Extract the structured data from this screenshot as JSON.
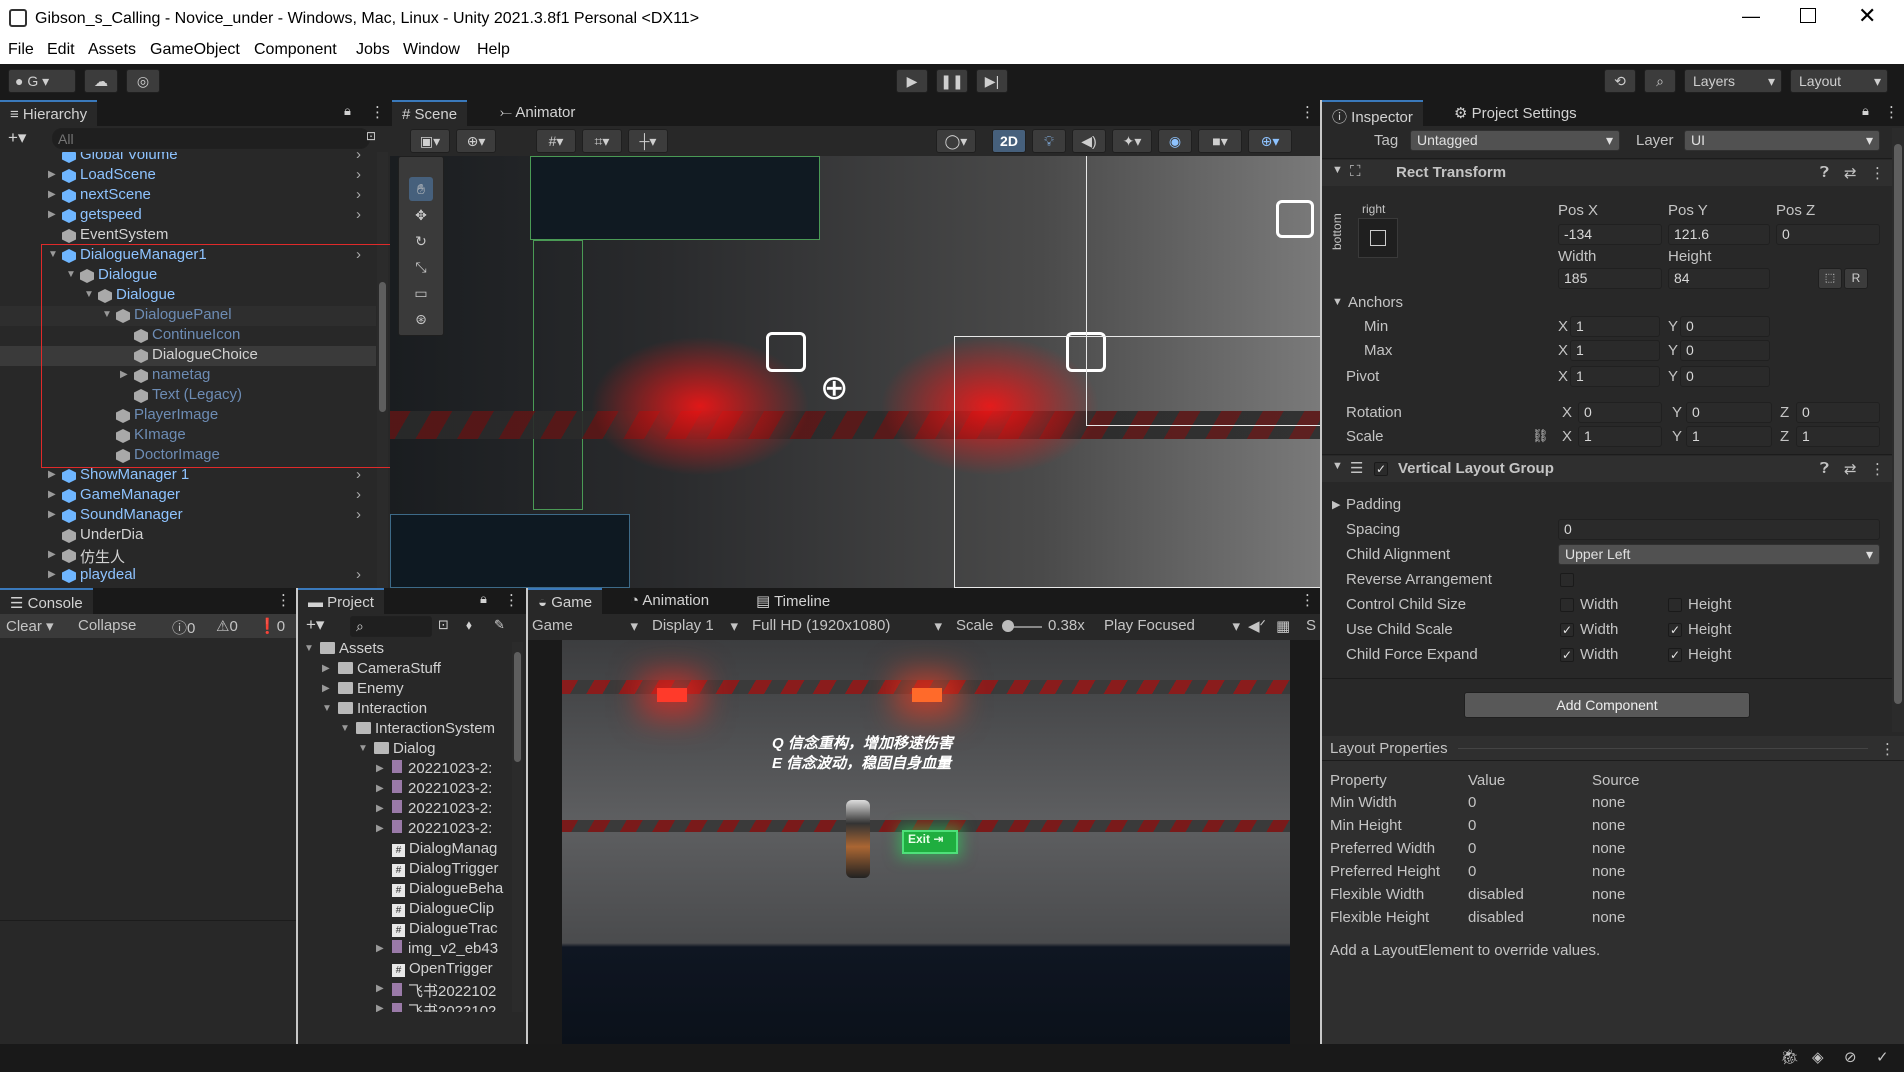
{
  "window": {
    "title": "Gibson_s_Calling - Novice_under - Windows, Mac, Linux - Unity 2021.3.8f1 Personal <DX11>"
  },
  "menu": [
    "File",
    "Edit",
    "Assets",
    "GameObject",
    "Component",
    "Jobs",
    "Window",
    "Help"
  ],
  "toolbar": {
    "account": "G",
    "layers": "Layers",
    "layout": "Layout"
  },
  "hierarchy": {
    "tab": "Hierarchy",
    "search_placeholder": "All",
    "items": [
      {
        "label": "Global Volume",
        "indent": 0,
        "exp": "",
        "icon": "cube",
        "style": "blue",
        "child": true
      },
      {
        "label": "LoadScene",
        "indent": 0,
        "exp": "▶",
        "icon": "cube",
        "style": "blue",
        "child": true
      },
      {
        "label": "nextScene",
        "indent": 0,
        "exp": "▶",
        "icon": "cube",
        "style": "blue",
        "child": true
      },
      {
        "label": "getspeed",
        "indent": 0,
        "exp": "▶",
        "icon": "cube",
        "style": "blue",
        "child": true
      },
      {
        "label": "EventSystem",
        "indent": 0,
        "exp": "",
        "icon": "cubeg",
        "style": "",
        "child": false
      },
      {
        "label": "DialogueManager1",
        "indent": 0,
        "exp": "▼",
        "icon": "cube",
        "style": "blue",
        "child": true
      },
      {
        "label": "Dialogue",
        "indent": 1,
        "exp": "▼",
        "icon": "cubeg",
        "style": "blue",
        "child": false
      },
      {
        "label": "Dialogue",
        "indent": 2,
        "exp": "▼",
        "icon": "cubeg",
        "style": "blue",
        "child": false
      },
      {
        "label": "DialoguePanel",
        "indent": 3,
        "exp": "▼",
        "icon": "cubeg",
        "style": "dim",
        "child": false
      },
      {
        "label": "ContinueIcon",
        "indent": 4,
        "exp": "",
        "icon": "cubeg",
        "style": "dim",
        "child": false
      },
      {
        "label": "DialogueChoice",
        "indent": 4,
        "exp": "",
        "icon": "cubeg",
        "style": "",
        "child": false
      },
      {
        "label": "nametag",
        "indent": 4,
        "exp": "▶",
        "icon": "cubeg",
        "style": "dim",
        "child": false
      },
      {
        "label": "Text (Legacy)",
        "indent": 4,
        "exp": "",
        "icon": "cubeg",
        "style": "dim",
        "child": false
      },
      {
        "label": "PlayerImage",
        "indent": 3,
        "exp": "",
        "icon": "cubeg",
        "style": "dim",
        "child": false
      },
      {
        "label": "KImage",
        "indent": 3,
        "exp": "",
        "icon": "cubeg",
        "style": "dim",
        "child": false
      },
      {
        "label": "DoctorImage",
        "indent": 3,
        "exp": "",
        "icon": "cubeg",
        "style": "dim",
        "child": false
      },
      {
        "label": "ShowManager 1",
        "indent": 0,
        "exp": "▶",
        "icon": "cube",
        "style": "blue",
        "child": true
      },
      {
        "label": "GameManager",
        "indent": 0,
        "exp": "▶",
        "icon": "cube",
        "style": "blue",
        "child": true
      },
      {
        "label": "SoundManager",
        "indent": 0,
        "exp": "▶",
        "icon": "cube",
        "style": "blue",
        "child": true
      },
      {
        "label": "UnderDia",
        "indent": 0,
        "exp": "",
        "icon": "cubeg",
        "style": "",
        "child": false
      },
      {
        "label": "仿生人",
        "indent": 0,
        "exp": "▶",
        "icon": "cubeg",
        "style": "",
        "child": false
      },
      {
        "label": "playdeal",
        "indent": 0,
        "exp": "▶",
        "icon": "cube",
        "style": "blue",
        "child": true
      }
    ]
  },
  "scene": {
    "tabs": [
      "Scene",
      "Animator"
    ],
    "mode2d": "2D"
  },
  "console": {
    "tab": "Console",
    "clear": "Clear",
    "collapse": "Collapse",
    "counts": [
      "0",
      "0",
      "0"
    ]
  },
  "project": {
    "tab": "Project",
    "items": [
      {
        "label": "Assets",
        "indent": 0,
        "exp": "▼",
        "kind": "folder"
      },
      {
        "label": "CameraStuff",
        "indent": 1,
        "exp": "▶",
        "kind": "folder"
      },
      {
        "label": "Enemy",
        "indent": 1,
        "exp": "▶",
        "kind": "folder"
      },
      {
        "label": "Interaction",
        "indent": 1,
        "exp": "▼",
        "kind": "folder"
      },
      {
        "label": "InteractionSystem",
        "indent": 2,
        "exp": "▼",
        "kind": "folder"
      },
      {
        "label": "Dialog",
        "indent": 3,
        "exp": "▼",
        "kind": "folder"
      },
      {
        "label": "20221023-2:",
        "indent": 4,
        "exp": "▶",
        "kind": "file"
      },
      {
        "label": "20221023-2:",
        "indent": 4,
        "exp": "▶",
        "kind": "file"
      },
      {
        "label": "20221023-2:",
        "indent": 4,
        "exp": "▶",
        "kind": "file"
      },
      {
        "label": "20221023-2:",
        "indent": 4,
        "exp": "▶",
        "kind": "file"
      },
      {
        "label": "DialogManag",
        "indent": 4,
        "exp": "",
        "kind": "script"
      },
      {
        "label": "DialogTrigger",
        "indent": 4,
        "exp": "",
        "kind": "script"
      },
      {
        "label": "DialogueBeha",
        "indent": 4,
        "exp": "",
        "kind": "script"
      },
      {
        "label": "DialogueClip",
        "indent": 4,
        "exp": "",
        "kind": "script"
      },
      {
        "label": "DialogueTrac",
        "indent": 4,
        "exp": "",
        "kind": "script"
      },
      {
        "label": "img_v2_eb43",
        "indent": 4,
        "exp": "▶",
        "kind": "file"
      },
      {
        "label": "OpenTrigger",
        "indent": 4,
        "exp": "",
        "kind": "script"
      },
      {
        "label": "飞书2022102",
        "indent": 4,
        "exp": "▶",
        "kind": "file"
      },
      {
        "label": "飞书2022102",
        "indent": 4,
        "exp": "▶",
        "kind": "file"
      }
    ]
  },
  "game": {
    "tabs": [
      "Game",
      "Animation",
      "Timeline"
    ],
    "display_mode": "Game",
    "display": "Display 1",
    "resolution": "Full HD (1920x1080)",
    "scale_label": "Scale",
    "scale_value": "0.38x",
    "play_focus": "Play Focused",
    "s_label": "S",
    "line1": "Q 信念重构，增加移速伤害",
    "line2": "E 信念波动，稳固自身血量",
    "exit": "Exit"
  },
  "inspector": {
    "tabs": [
      "Inspector",
      "Project Settings"
    ],
    "tag_label": "Tag",
    "tag": "Untagged",
    "layer_label": "Layer",
    "layer": "UI",
    "rect": {
      "title": "Rect Transform",
      "anchor_h": "right",
      "anchor_v": "bottom",
      "posx_label": "Pos X",
      "posy_label": "Pos Y",
      "posz_label": "Pos Z",
      "posx": "-134",
      "posy": "121.6",
      "posz": "0",
      "width_label": "Width",
      "height_label": "Height",
      "width": "185",
      "height": "84",
      "r_btn": "R",
      "anchors": "Anchors",
      "min": "Min",
      "max": "Max",
      "min_x": "1",
      "min_y": "0",
      "max_x": "1",
      "max_y": "0",
      "pivot": "Pivot",
      "pivot_x": "1",
      "pivot_y": "0",
      "rotation": "Rotation",
      "rot_x": "0",
      "rot_y": "0",
      "rot_z": "0",
      "scale": "Scale",
      "sc_x": "1",
      "sc_y": "1",
      "sc_z": "1",
      "x": "X",
      "y": "Y",
      "z": "Z"
    },
    "vlg": {
      "title": "Vertical Layout Group",
      "padding": "Padding",
      "spacing": "Spacing",
      "spacing_value": "0",
      "child_alignment": "Child Alignment",
      "alignment_value": "Upper Left",
      "reverse": "Reverse Arrangement",
      "control_size": "Control Child Size",
      "use_scale": "Use Child Scale",
      "force_expand": "Child Force Expand",
      "width": "Width",
      "height": "Height",
      "checks": {
        "control_w": "",
        "control_h": "",
        "scale_w": "✓",
        "scale_h": "✓",
        "expand_w": "✓",
        "expand_h": "✓"
      }
    },
    "add_component": "Add Component",
    "layout_props": {
      "title": "Layout Properties",
      "headers": [
        "Property",
        "Value",
        "Source"
      ],
      "rows": [
        [
          "Min Width",
          "0",
          "none"
        ],
        [
          "Min Height",
          "0",
          "none"
        ],
        [
          "Preferred Width",
          "0",
          "none"
        ],
        [
          "Preferred Height",
          "0",
          "none"
        ],
        [
          "Flexible Width",
          "disabled",
          "none"
        ],
        [
          "Flexible Height",
          "disabled",
          "none"
        ]
      ],
      "note": "Add a LayoutElement to override values."
    }
  }
}
